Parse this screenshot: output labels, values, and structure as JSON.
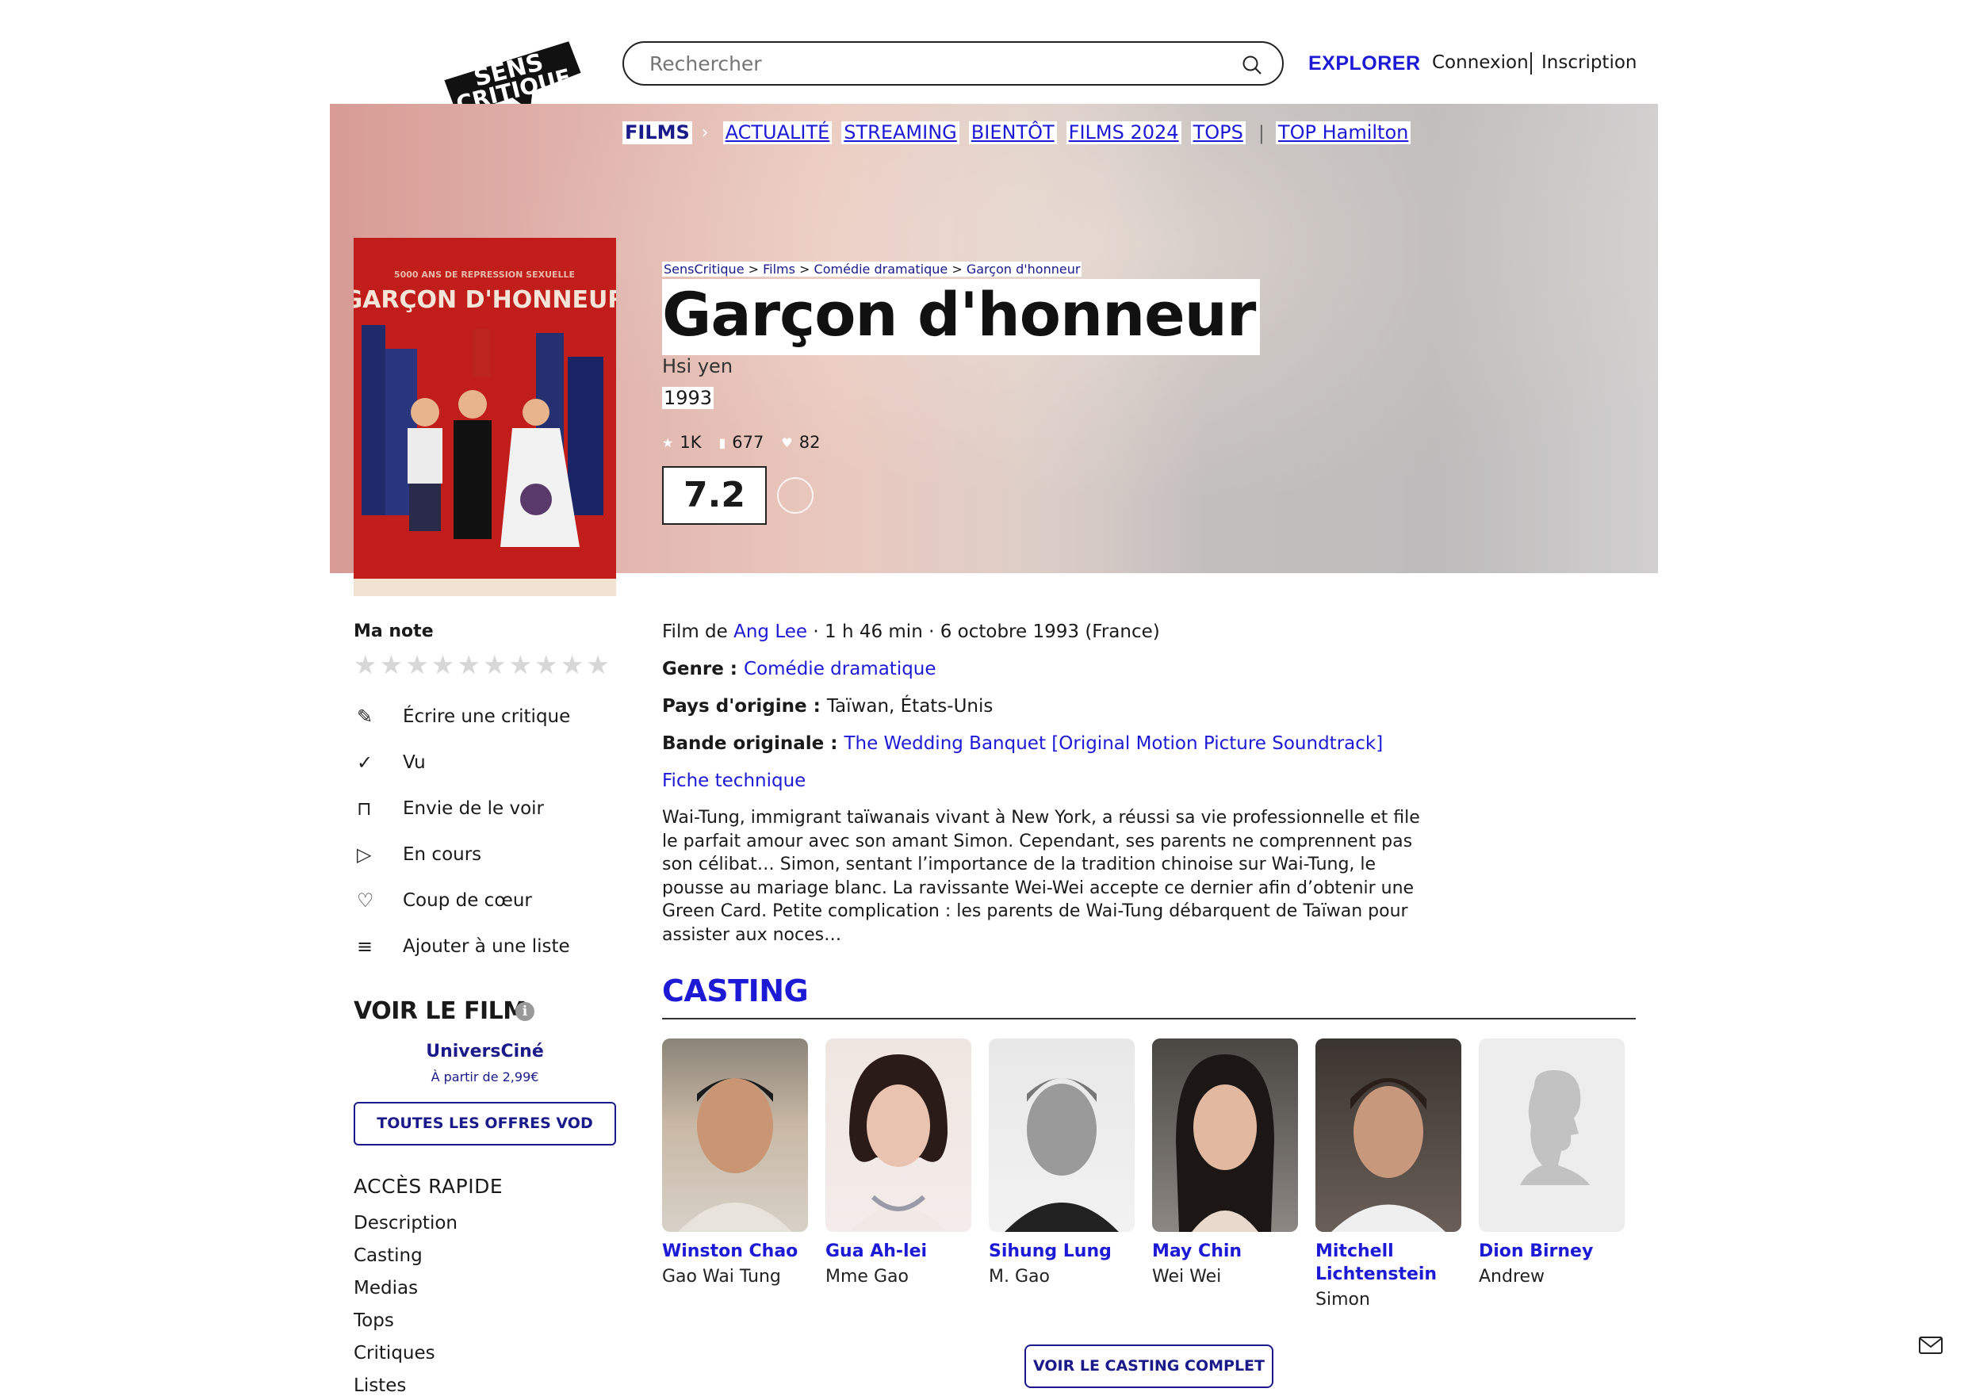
{
  "header": {
    "logo_text_1": "SENS",
    "logo_text_2": "CRITIQUE",
    "search_placeholder": "Rechercher",
    "explore": "EXPLORER",
    "login": "Connexion",
    "signup": "Inscription"
  },
  "nav": {
    "films": "FILMS",
    "items": [
      "ACTUALITÉ",
      "STREAMING",
      "BIENTÔT",
      "FILMS 2024",
      "TOPS"
    ],
    "extra": "TOP Hamilton"
  },
  "poster": {
    "tagline": "5000 ANS DE REPRESSION SEXUELLE",
    "title": "GARÇON D'HONNEUR"
  },
  "breadcrumb": [
    "SensCritique",
    "Films",
    "Comédie dramatique",
    "Garçon d'honneur"
  ],
  "movie": {
    "title": "Garçon d'honneur",
    "original_title": "Hsi yen",
    "year": "1993",
    "stats": [
      "1K",
      "677",
      "82"
    ],
    "rating": "7.2"
  },
  "actions": {
    "my_note": "Ma note",
    "stars_count": 10,
    "list": [
      {
        "icon": "pencil-icon",
        "label": "Écrire une critique"
      },
      {
        "icon": "check-icon",
        "label": "Vu"
      },
      {
        "icon": "bookmark-icon",
        "label": "Envie de le voir"
      },
      {
        "icon": "play-icon",
        "label": "En cours"
      },
      {
        "icon": "heart-icon",
        "label": "Coup de cœur"
      },
      {
        "icon": "add-list-icon",
        "label": "Ajouter à une liste"
      }
    ]
  },
  "vod": {
    "title": "VOIR LE FILM",
    "provider": "UniversCiné",
    "price": "À partir de 2,99€",
    "button": "TOUTES LES OFFRES VOD"
  },
  "quick_access": {
    "title": "ACCÈS RAPIDE",
    "items": [
      "Description",
      "Casting",
      "Medias",
      "Tops",
      "Critiques",
      "Listes"
    ]
  },
  "details": {
    "film_de_prefix": "Film de ",
    "director": "Ang Lee",
    "meta": " · 1 h 46 min · 6 octobre 1993 (France)",
    "genre_label": "Genre : ",
    "genre": "Comédie dramatique",
    "country_label": "Pays d'origine : ",
    "country": "Taïwan, États-Unis",
    "soundtrack_label": "Bande originale : ",
    "soundtrack": "The Wedding Banquet [Original Motion Picture Soundtrack]",
    "tech_sheet": "Fiche technique",
    "synopsis": "Wai-Tung, immigrant taïwanais vivant à New York, a réussi sa vie professionnelle et file le parfait amour avec son amant Simon. Cependant, ses parents ne comprennent pas son célibat… Simon, sentant l’importance de la tradition chinoise sur Wai-Tung, le pousse au mariage blanc. La ravissante Wei-Wei accepte ce dernier afin d’obtenir une Green Card. Petite complication : les parents de Wai-Tung débarquent de Taïwan pour assister aux noces…"
  },
  "casting": {
    "title": "CASTING",
    "button": "VOIR LE CASTING COMPLET",
    "actors": [
      {
        "name": "Winston Chao",
        "role": "Gao Wai Tung"
      },
      {
        "name": "Gua Ah-lei",
        "role": "Mme Gao"
      },
      {
        "name": "Sihung Lung",
        "role": "M. Gao"
      },
      {
        "name": "May Chin",
        "role": "Wei Wei"
      },
      {
        "name": "Mitchell Lichtenstein",
        "role": "Simon"
      },
      {
        "name": "Dion Birney",
        "role": "Andrew"
      }
    ]
  }
}
